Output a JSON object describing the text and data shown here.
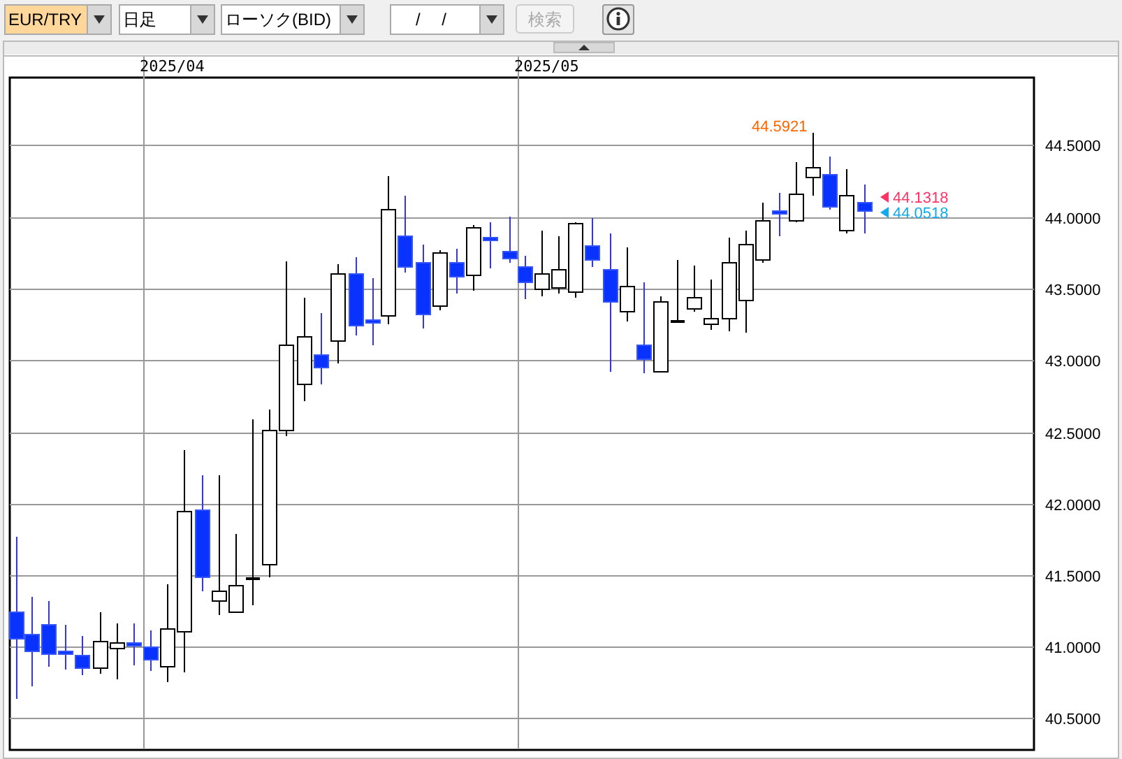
{
  "toolbar": {
    "selects": [
      {
        "value": "EUR/TRY",
        "highlighted": true
      },
      {
        "value": "日足",
        "highlighted": false
      },
      {
        "value": "ローソク(BID)",
        "highlighted": false
      }
    ],
    "date_field": {
      "value": "/ /"
    },
    "search_button": {
      "label": "検索",
      "disabled": true
    }
  },
  "chart": {
    "date_labels": [
      "2025/04",
      "2025/05"
    ],
    "y_labels": [
      "44.5000",
      "44.0000",
      "43.5000",
      "43.0000",
      "42.5000",
      "42.0000",
      "41.5000",
      "41.0000",
      "40.5000"
    ],
    "high_label": {
      "text": "44.5921",
      "color": "#ff6600"
    },
    "price_markers": [
      {
        "text": "44.1318",
        "color": "#ff3366"
      },
      {
        "text": "44.0518",
        "color": "#11aaee"
      }
    ]
  }
}
